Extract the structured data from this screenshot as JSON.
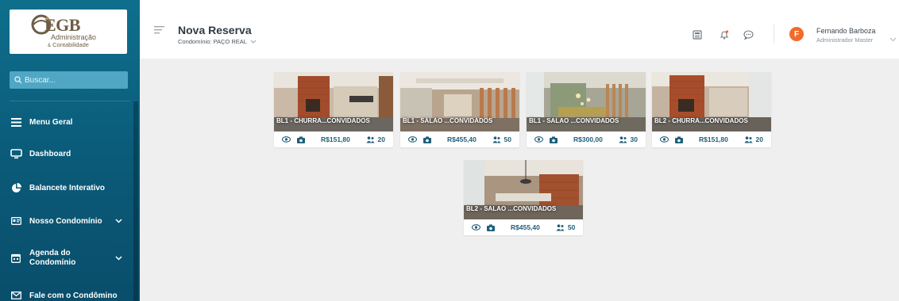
{
  "sidebar": {
    "logo": {
      "brand": "EGB",
      "line1": "Administração",
      "line2_prefix": "&",
      "line2": "Contabilidade"
    },
    "search_placeholder": "Buscar...",
    "items": [
      {
        "label": "Menu Geral",
        "icon": "hamburger-icon"
      },
      {
        "label": "Dashboard",
        "icon": "monitor-icon"
      },
      {
        "label": "Balancete Interativo",
        "icon": "pie-chart-icon"
      },
      {
        "label": "Nosso Condomínio",
        "icon": "id-card-icon",
        "expandable": true
      },
      {
        "label": "Agenda do Condomínio",
        "label_line1": "Agenda do",
        "label_line2": "Condomínio",
        "icon": "calendar-icon",
        "expandable": true
      },
      {
        "label": "Fale com o Condômino",
        "icon": "mail-icon"
      }
    ]
  },
  "header": {
    "title": "Nova Reserva",
    "condo_label": "Condomínio: PAÇO REAL",
    "icons": [
      "newspaper-icon",
      "bell-icon",
      "chat-icon"
    ],
    "user": {
      "initial": "F",
      "name": "Fernando Barboza",
      "role": "Administrador Master"
    }
  },
  "colors": {
    "sidebar": "#0a5a78",
    "accent": "#1f5f7a",
    "avatar": "#f26a2c",
    "search": "#4fa7c4"
  },
  "cards": [
    {
      "caption": "BL1 - CHURRA...CONVIDADOS",
      "price": "R$151,80",
      "capacity": "20",
      "scene": "bbq"
    },
    {
      "caption": "BL1 - SALAO ...CONVIDADOS",
      "price": "R$455,40",
      "capacity": "50",
      "scene": "hall"
    },
    {
      "caption": "BL1 - SALAO ...CONVIDADOS",
      "price": "R$300,00",
      "capacity": "30",
      "scene": "party"
    },
    {
      "caption": "BL2 - CHURRA...CONVIDADOS",
      "price": "R$151,80",
      "capacity": "20",
      "scene": "bbq"
    },
    {
      "caption": "BL2 - SALAO ...CONVIDADOS",
      "price": "R$455,40",
      "capacity": "50",
      "scene": "hall2"
    }
  ]
}
